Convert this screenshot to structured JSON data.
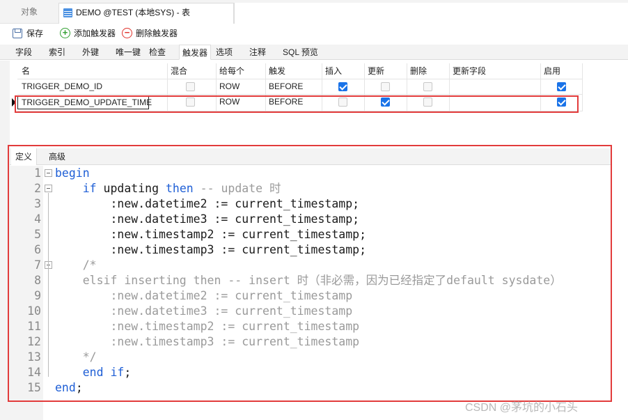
{
  "top_tabs": {
    "objects": "对象",
    "active": "DEMO @TEST (本地SYS) - 表"
  },
  "toolbar": {
    "save": "保存",
    "add_trigger": "添加触发器",
    "delete_trigger": "删除触发器"
  },
  "sub_tabs": [
    "字段",
    "索引",
    "外键",
    "唯一键",
    "检查",
    "触发器",
    "选项",
    "注释",
    "SQL 预览"
  ],
  "active_sub_tab": "触发器",
  "grid": {
    "columns": [
      "名",
      "混合",
      "给每个",
      "触发",
      "插入",
      "更新",
      "删除",
      "更新字段",
      "启用"
    ],
    "rows": [
      {
        "name": "TRIGGER_DEMO_ID",
        "mixed": false,
        "for_each": "ROW",
        "fire": "BEFORE",
        "insert": true,
        "update": false,
        "delete": false,
        "update_fields": "",
        "enabled": true
      },
      {
        "name": "TRIGGER_DEMO_UPDATE_TIME",
        "mixed": false,
        "for_each": "ROW",
        "fire": "BEFORE",
        "insert": false,
        "update": true,
        "delete": false,
        "update_fields": "",
        "enabled": true
      }
    ]
  },
  "def_tabs": [
    "定义",
    "高级"
  ],
  "code_lines": [
    [
      [
        "kw",
        "begin"
      ]
    ],
    [
      [
        "tx",
        "    "
      ],
      [
        "kw",
        "if"
      ],
      [
        "tx",
        " updating "
      ],
      [
        "kw",
        "then"
      ],
      [
        "cm",
        " -- update 时"
      ]
    ],
    [
      [
        "tx",
        "        :new.datetime2 := current_timestamp;"
      ]
    ],
    [
      [
        "tx",
        "        :new.datetime3 := current_timestamp;"
      ]
    ],
    [
      [
        "tx",
        "        :new.timestamp2 := current_timestamp;"
      ]
    ],
    [
      [
        "tx",
        "        :new.timestamp3 := current_timestamp;"
      ]
    ],
    [
      [
        "cm",
        "    /*"
      ]
    ],
    [
      [
        "cm",
        "    elsif inserting then -- insert 时（非必需，因为已经指定了default sysdate）"
      ]
    ],
    [
      [
        "cm",
        "        :new.datetime2 := current_timestamp"
      ]
    ],
    [
      [
        "cm",
        "        :new.datetime3 := current_timestamp"
      ]
    ],
    [
      [
        "cm",
        "        :new.timestamp2 := current_timestamp"
      ]
    ],
    [
      [
        "cm",
        "        :new.timestamp3 := current_timestamp"
      ]
    ],
    [
      [
        "cm",
        "    */"
      ]
    ],
    [
      [
        "tx",
        "    "
      ],
      [
        "kw",
        "end if"
      ],
      [
        "tx",
        ";"
      ]
    ],
    [
      [
        "kw",
        "end"
      ],
      [
        "tx",
        ";"
      ]
    ]
  ],
  "watermark": "CSDN @茅坑的小石头"
}
